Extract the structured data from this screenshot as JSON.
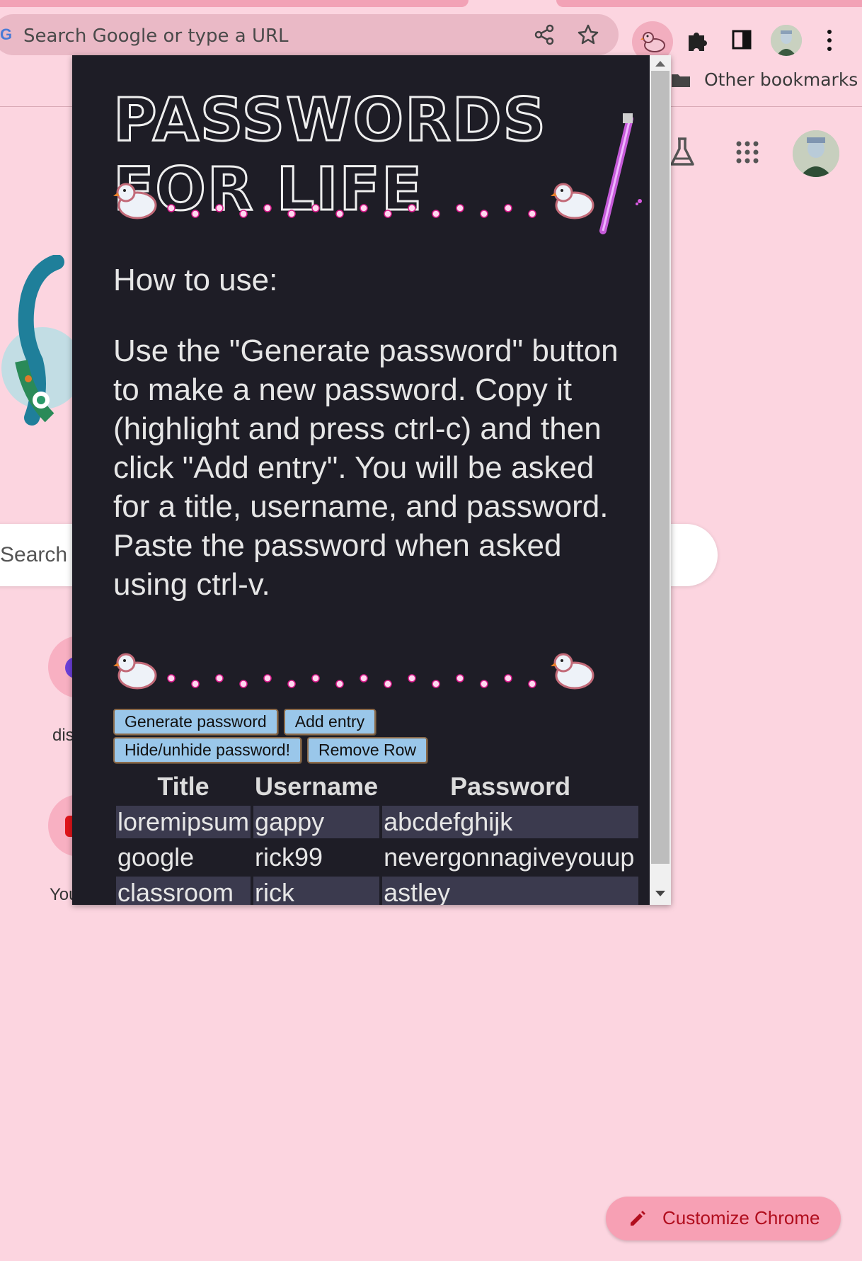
{
  "browser": {
    "omnibox_placeholder": "Search Google or type a URL",
    "bookmarks": {
      "other_label": "Other bookmarks"
    }
  },
  "ntp": {
    "search_placeholder": "Search",
    "shortcuts": [
      {
        "label": "dis"
      },
      {
        "label": "You"
      }
    ],
    "customize_label": "Customize Chrome"
  },
  "popup": {
    "title": "PASSWORDS FOR LIFE",
    "howto_heading": "How to use:",
    "instructions": "Use the \"Generate password\" button to make a new password. Copy it (highlight and press ctrl-c) and then click \"Add entry\". You will be asked for a title, username, and password. Paste the password when asked using ctrl-v.",
    "buttons": {
      "generate": "Generate password",
      "add": "Add entry",
      "hide": "Hide/unhide password!",
      "remove": "Remove Row"
    },
    "table": {
      "headers": [
        "Title",
        "Username",
        "Password"
      ],
      "rows": [
        [
          "loremipsum",
          "gappy",
          "abcdefghijk"
        ],
        [
          "google",
          "rick99",
          "nevergonnagiveyouup"
        ],
        [
          "classroom",
          "rick",
          "astley"
        ]
      ]
    }
  },
  "colors": {
    "page_bg": "#fcd5e0",
    "popup_bg": "#1e1d26",
    "button_bg": "#9ac7ea",
    "accent_red": "#b10e1e"
  }
}
